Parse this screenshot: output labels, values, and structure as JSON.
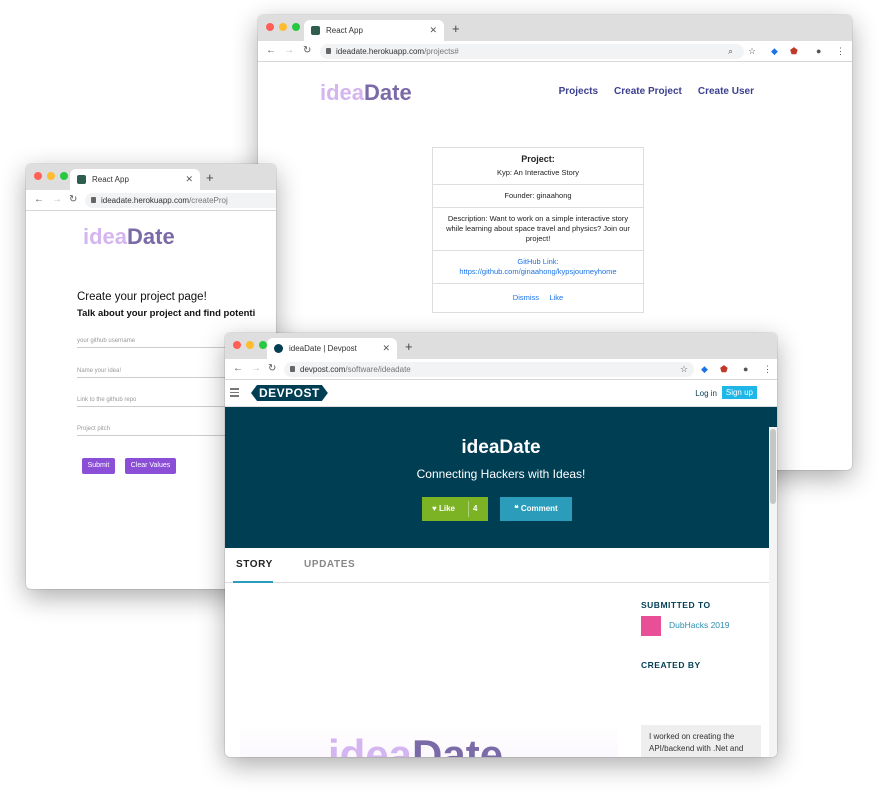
{
  "colors": {
    "brand_light": "#d4b5f0",
    "brand_dark": "#7b6aa8",
    "devpost_navy": "#003e54",
    "like_green": "#7bb324",
    "comment_blue": "#2b9cba",
    "purple_button": "#8a4fd6"
  },
  "win_projects": {
    "tab_title": "React App",
    "url_host": "ideadate.herokuapp.com",
    "url_path": "/projects#",
    "logo": {
      "part1": "idea",
      "part2": "Date"
    },
    "nav": {
      "projects": "Projects",
      "create_project": "Create Project",
      "create_user": "Create User"
    },
    "card": {
      "heading": "Project:",
      "name": "Kyp: An Interactive Story",
      "founder": "Founder: ginaahong",
      "description": "Description: Want to work on a simple interactive story while learning about space travel and physics? Join our project!",
      "github_label": "GitHub Link:",
      "github_url": "https://github.com/ginaahong/kypsjourneyhome",
      "dismiss": "Dismiss",
      "like": "Like"
    }
  },
  "win_create": {
    "tab_title": "React App",
    "url_host": "ideadate.herokuapp.com",
    "url_path": "/createProj",
    "logo": {
      "part1": "idea",
      "part2": "Date"
    },
    "heading": "Create your project page!",
    "subheading": "Talk about your project and find potenti",
    "fields": {
      "github_user": "your github username",
      "idea_name": "Name your idea!",
      "repo_link": "Link to the github repo",
      "pitch": "Project pitch"
    },
    "buttons": {
      "submit": "Submit",
      "clear": "Clear Values"
    }
  },
  "win_devpost": {
    "tab_title": "ideaDate | Devpost",
    "url_host": "devpost.com",
    "url_path": "/software/ideadate",
    "devpost_logo": "DEVPOST",
    "login": "Log in",
    "signup": "Sign up",
    "title": "ideaDate",
    "tagline": "Connecting Hackers with Ideas!",
    "like_label": "Like",
    "like_count": "4",
    "comment_label": "Comment",
    "tabs": {
      "story": "STORY",
      "updates": "UPDATES"
    },
    "submitted_to": "SUBMITTED TO",
    "hackathon": "DubHacks 2019",
    "created_by": "CREATED BY",
    "creator_note": "I worked on creating the API/backend with .Net and MongoDB. I tried to jump in and help with the frontend, although I was a bit out of my domain",
    "image_logo": {
      "part1": "idea",
      "part2": "Date"
    }
  }
}
